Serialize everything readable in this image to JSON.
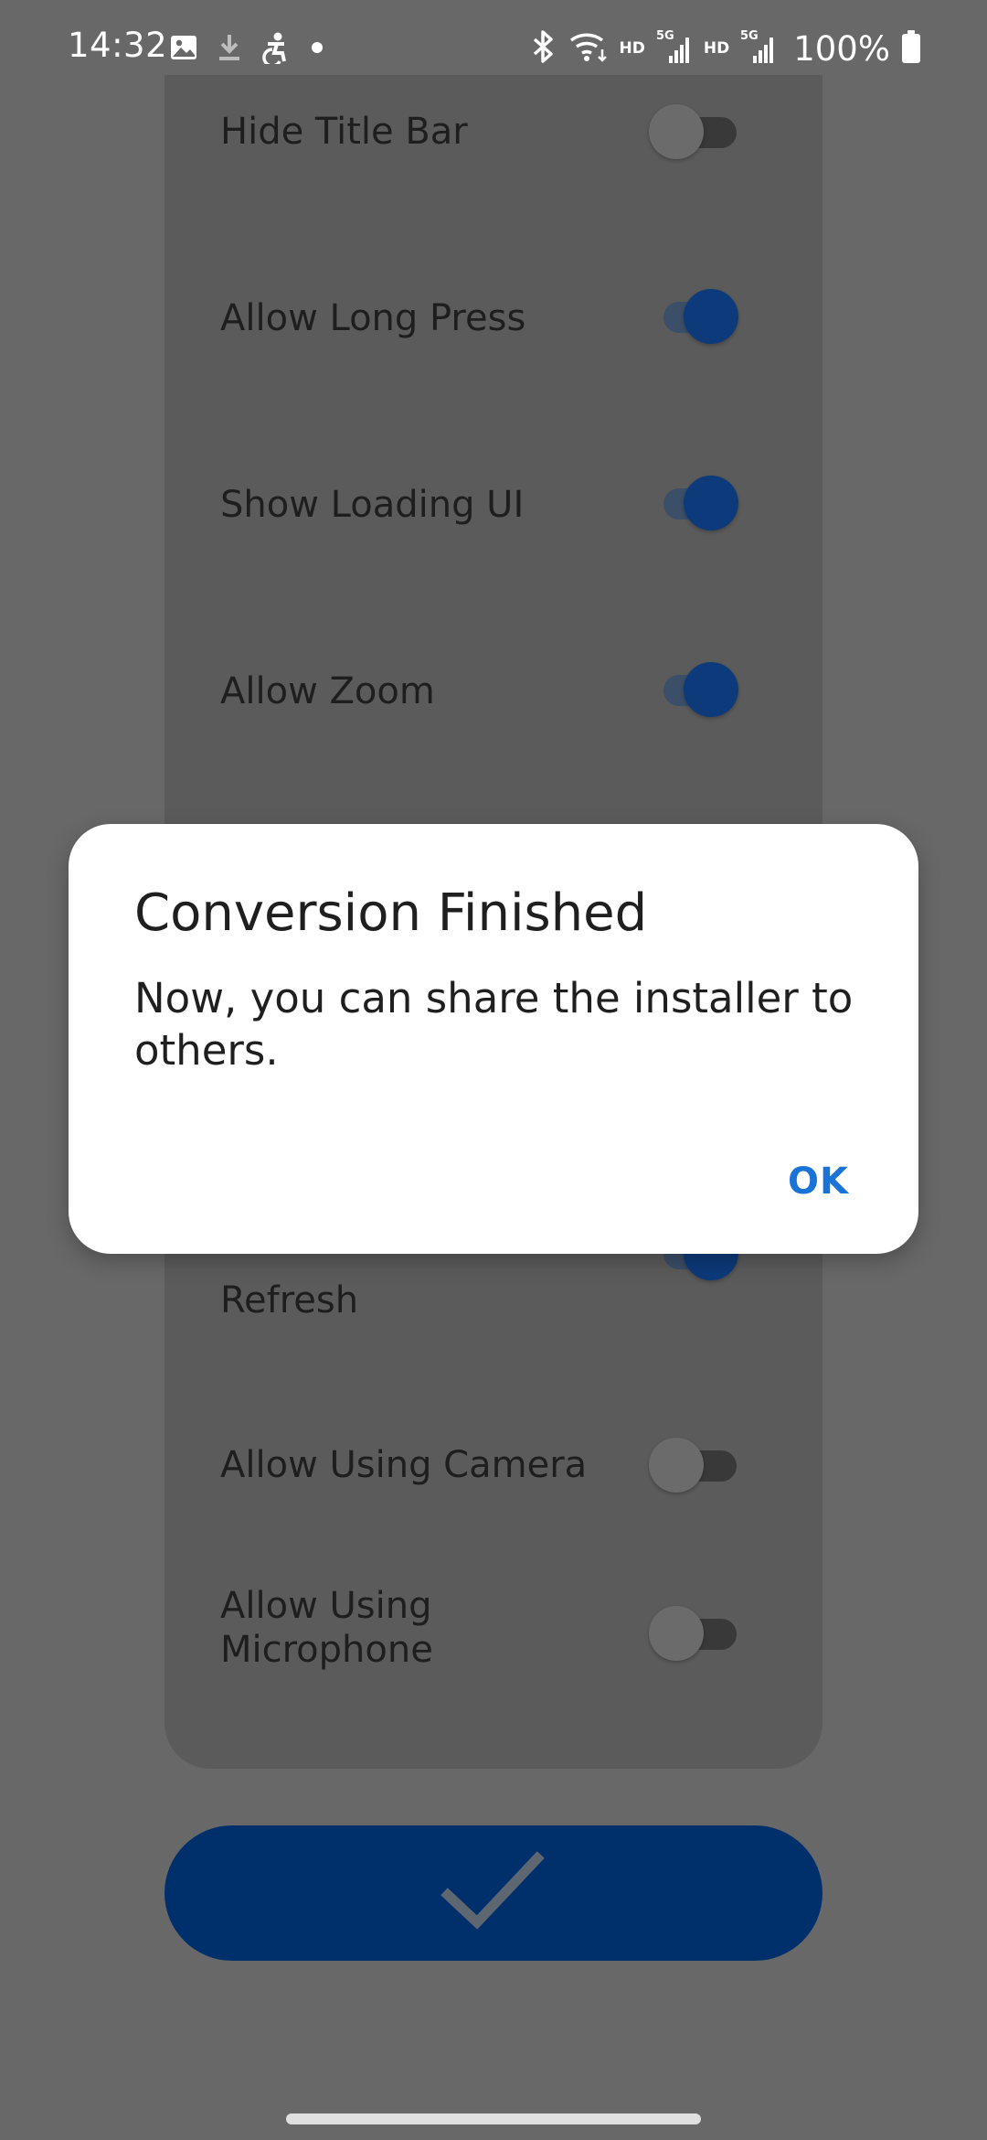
{
  "status_bar": {
    "time": "14:32",
    "battery": "100%",
    "hd_1": "HD",
    "hd_2": "HD",
    "icons": [
      "gallery-icon",
      "download-icon",
      "accessibility-icon",
      "notification-dot-icon",
      "bluetooth-icon",
      "wifi-icon",
      "signal-icon",
      "battery-icon"
    ]
  },
  "settings": {
    "hide_title_bar": {
      "label": "Hide Title Bar",
      "enabled": false
    },
    "allow_long_press": {
      "label": "Allow Long Press",
      "enabled": true
    },
    "show_loading_ui": {
      "label": "Show Loading UI",
      "enabled": true
    },
    "allow_zoom": {
      "label": "Allow Zoom",
      "enabled": true
    },
    "refresh": {
      "label": "Refresh",
      "enabled": true
    },
    "allow_using_camera": {
      "label": "Allow Using Camera",
      "enabled": false
    },
    "allow_using_microphone": {
      "label_line1": "Allow Using",
      "label_line2": "Microphone",
      "enabled": false
    }
  },
  "confirm_button": {
    "icon": "checkmark-icon"
  },
  "dialog": {
    "title": "Conversion Finished",
    "message": "Now, you can share the installer to others.",
    "ok_label": "OK"
  },
  "colors": {
    "accent": "#1a73d6",
    "button_fill": "#00306b",
    "scrim": "#686868"
  }
}
